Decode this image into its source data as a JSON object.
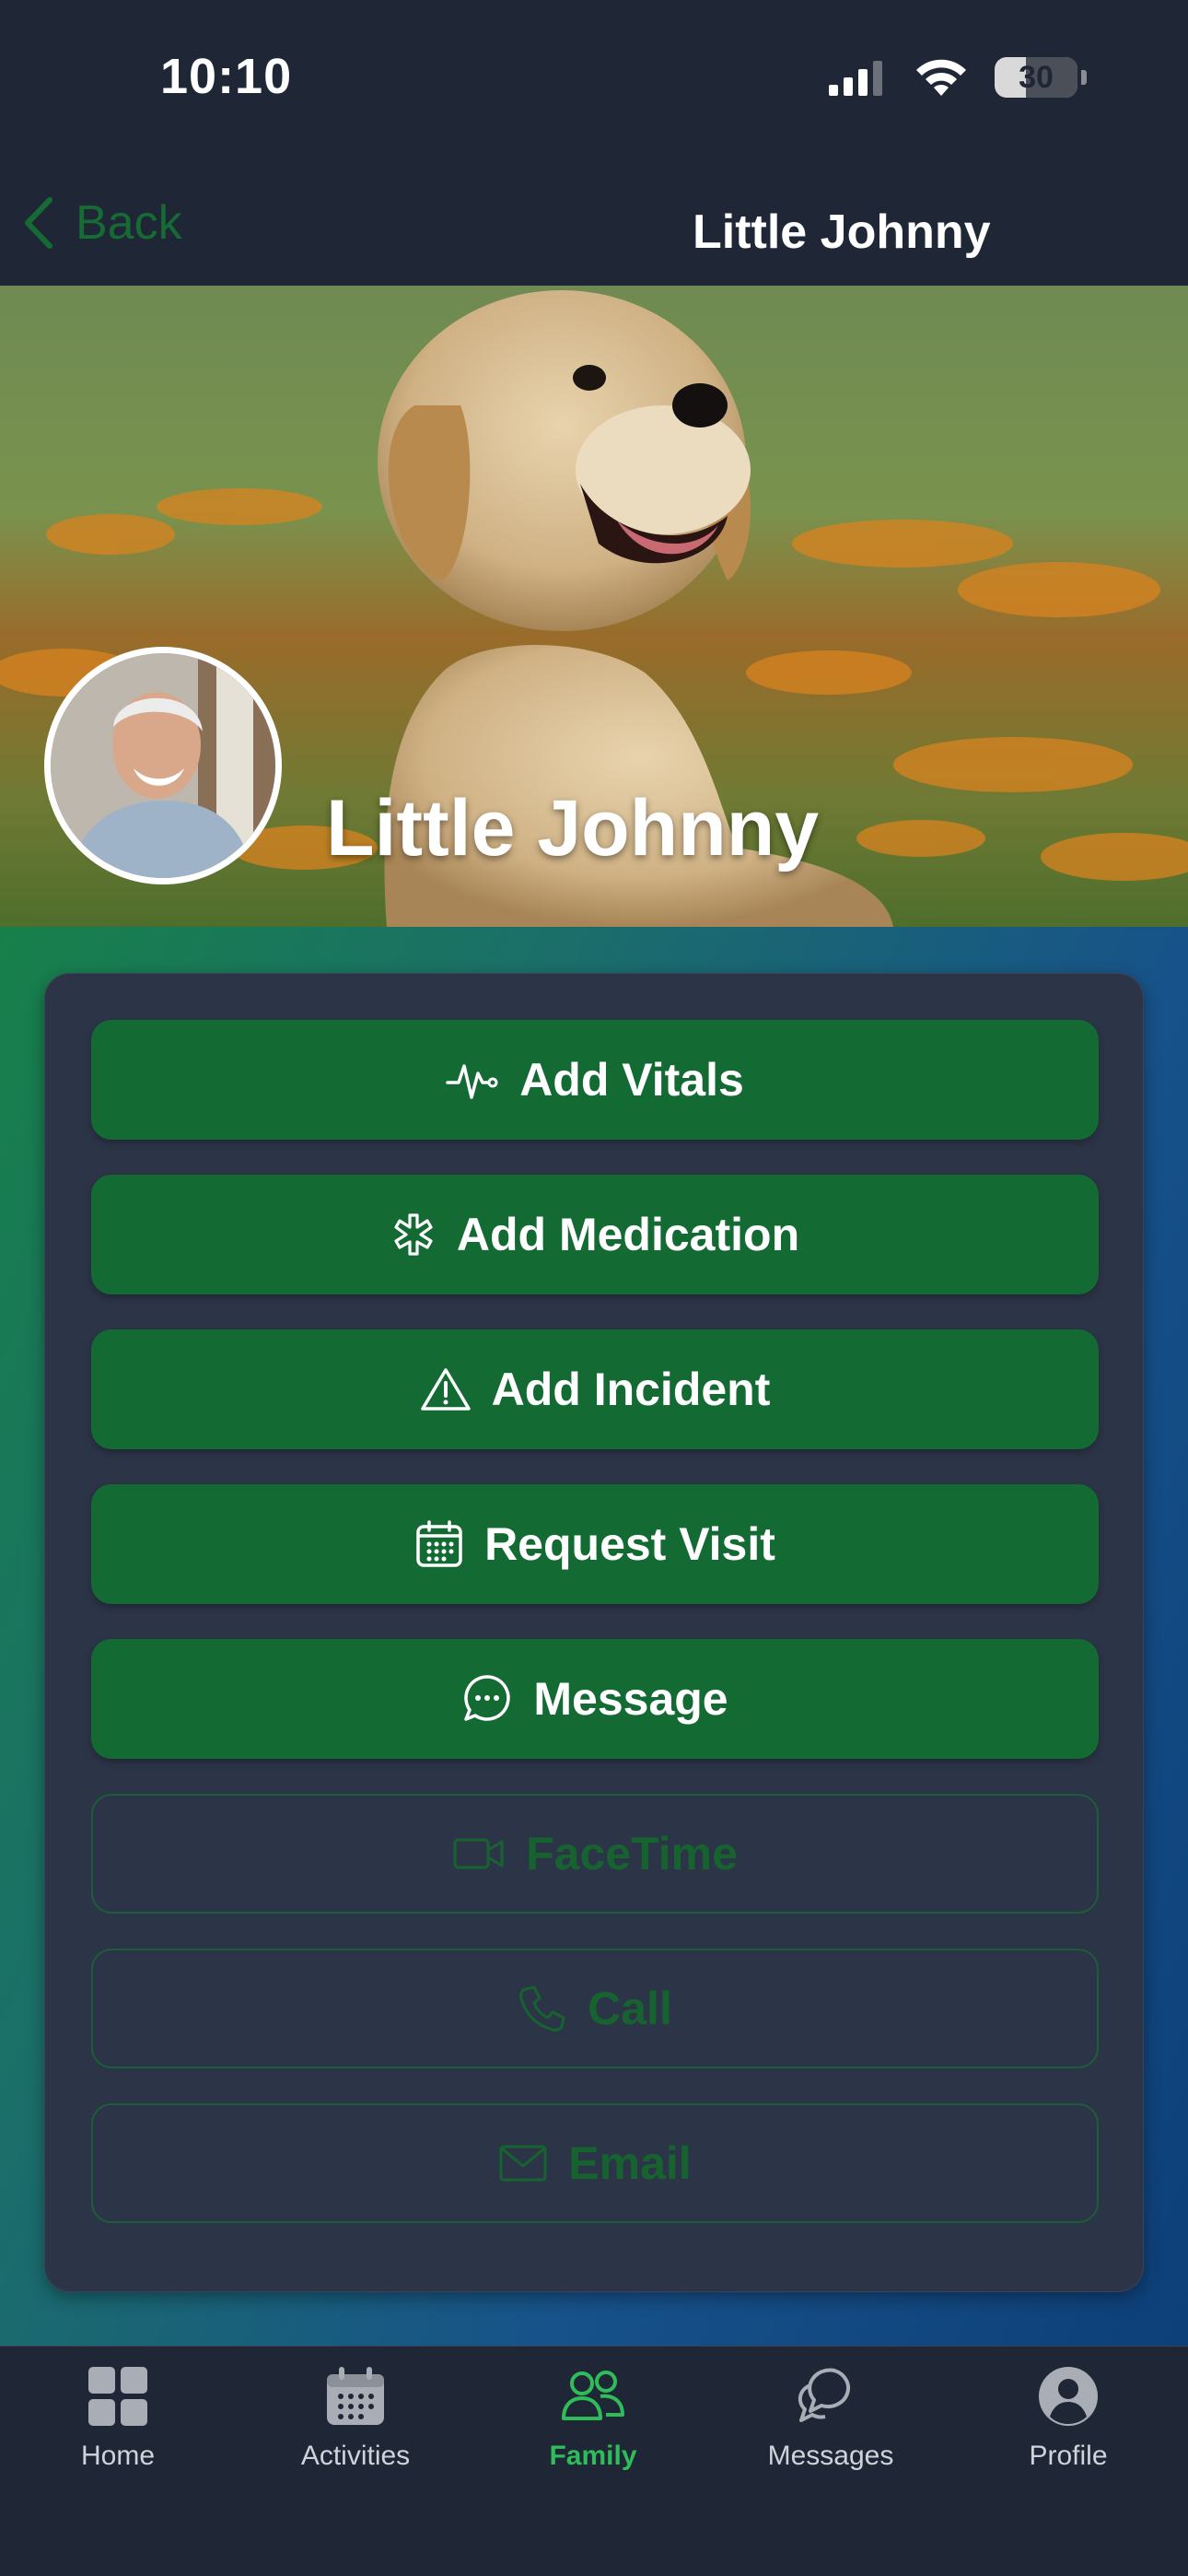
{
  "status_bar": {
    "time": "10:10",
    "battery": "30"
  },
  "nav": {
    "back_label": "Back",
    "title": "Little Johnny"
  },
  "hero": {
    "name": "Little Johnny"
  },
  "actions": [
    {
      "label": "Add Vitals",
      "icon": "pulse-icon",
      "style": "solid"
    },
    {
      "label": "Add Medication",
      "icon": "medical-asterisk-icon",
      "style": "solid"
    },
    {
      "label": "Add Incident",
      "icon": "warning-triangle-icon",
      "style": "solid"
    },
    {
      "label": "Request Visit",
      "icon": "calendar-icon",
      "style": "solid"
    },
    {
      "label": "Message",
      "icon": "chat-bubble-icon",
      "style": "solid"
    },
    {
      "label": "FaceTime",
      "icon": "video-camera-icon",
      "style": "outline-disabled"
    },
    {
      "label": "Call",
      "icon": "phone-icon",
      "style": "outline-disabled"
    },
    {
      "label": "Email",
      "icon": "envelope-icon",
      "style": "outline-disabled"
    }
  ],
  "tabs": [
    {
      "label": "Home",
      "icon": "grid-icon",
      "active": false
    },
    {
      "label": "Activities",
      "icon": "calendar-icon",
      "active": false
    },
    {
      "label": "Family",
      "icon": "people-icon",
      "active": true
    },
    {
      "label": "Messages",
      "icon": "chat-bubbles-icon",
      "active": false
    },
    {
      "label": "Profile",
      "icon": "person-circle-icon",
      "active": false
    }
  ],
  "colors": {
    "background": "#1f2736",
    "primary_green": "#136b33",
    "active_tab": "#2fbd5a",
    "card": "#2c3447"
  }
}
